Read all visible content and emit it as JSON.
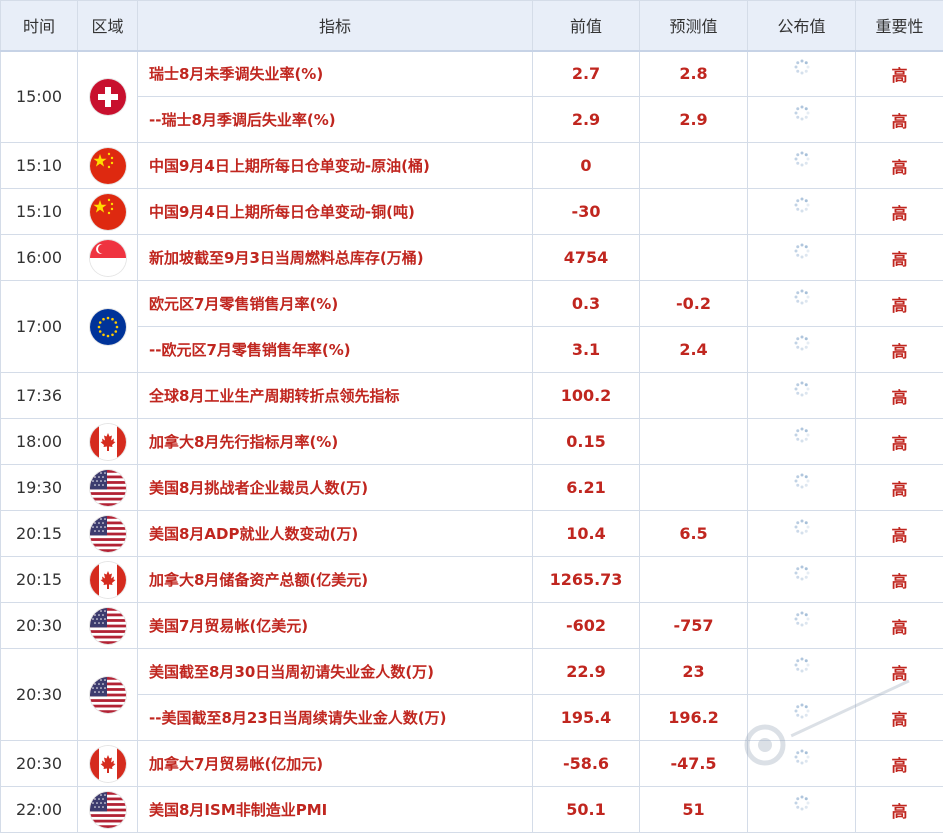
{
  "header": {
    "time": "时间",
    "region": "区域",
    "indicator": "指标",
    "previous": "前值",
    "forecast": "预测值",
    "published": "公布值",
    "importance": "重要性"
  },
  "colors": {
    "accent_red": "#c0261f",
    "header_bg": "#e8eef8",
    "border": "#d4dce8"
  },
  "groups": [
    {
      "time": "15:00",
      "flag": "switzerland-flag-icon",
      "rows": [
        {
          "indicator": "瑞士8月未季调失业率(%)",
          "previous": "2.7",
          "forecast": "2.8",
          "importance": "高"
        },
        {
          "indicator": "--瑞士8月季调后失业率(%)",
          "previous": "2.9",
          "forecast": "2.9",
          "importance": "高"
        }
      ]
    },
    {
      "time": "15:10",
      "flag": "china-flag-icon",
      "rows": [
        {
          "indicator": "中国9月4日上期所每日仓单变动-原油(桶)",
          "previous": "0",
          "forecast": "",
          "importance": "高"
        }
      ]
    },
    {
      "time": "15:10",
      "flag": "china-flag-icon",
      "rows": [
        {
          "indicator": "中国9月4日上期所每日仓单变动-铜(吨)",
          "previous": "-30",
          "forecast": "",
          "importance": "高"
        }
      ]
    },
    {
      "time": "16:00",
      "flag": "singapore-flag-icon",
      "rows": [
        {
          "indicator": "新加坡截至9月3日当周燃料总库存(万桶)",
          "previous": "4754",
          "forecast": "",
          "importance": "高"
        }
      ]
    },
    {
      "time": "17:00",
      "flag": "eu-flag-icon",
      "rows": [
        {
          "indicator": "欧元区7月零售销售月率(%)",
          "previous": "0.3",
          "forecast": "-0.2",
          "importance": "高"
        },
        {
          "indicator": "--欧元区7月零售销售年率(%)",
          "previous": "3.1",
          "forecast": "2.4",
          "importance": "高"
        }
      ]
    },
    {
      "time": "17:36",
      "flag": "",
      "rows": [
        {
          "indicator": "全球8月工业生产周期转折点领先指标",
          "previous": "100.2",
          "forecast": "",
          "importance": "高"
        }
      ]
    },
    {
      "time": "18:00",
      "flag": "canada-flag-icon",
      "rows": [
        {
          "indicator": "加拿大8月先行指标月率(%)",
          "previous": "0.15",
          "forecast": "",
          "importance": "高"
        }
      ]
    },
    {
      "time": "19:30",
      "flag": "usa-flag-icon",
      "rows": [
        {
          "indicator": "美国8月挑战者企业裁员人数(万)",
          "previous": "6.21",
          "forecast": "",
          "importance": "高"
        }
      ]
    },
    {
      "time": "20:15",
      "flag": "usa-flag-icon",
      "rows": [
        {
          "indicator": "美国8月ADP就业人数变动(万)",
          "previous": "10.4",
          "forecast": "6.5",
          "importance": "高"
        }
      ]
    },
    {
      "time": "20:15",
      "flag": "canada-flag-icon",
      "rows": [
        {
          "indicator": "加拿大8月储备资产总额(亿美元)",
          "previous": "1265.73",
          "forecast": "",
          "importance": "高"
        }
      ]
    },
    {
      "time": "20:30",
      "flag": "usa-flag-icon",
      "rows": [
        {
          "indicator": "美国7月贸易帐(亿美元)",
          "previous": "-602",
          "forecast": "-757",
          "importance": "高"
        }
      ]
    },
    {
      "time": "20:30",
      "flag": "usa-flag-icon",
      "rows": [
        {
          "indicator": "美国截至8月30日当周初请失业金人数(万)",
          "previous": "22.9",
          "forecast": "23",
          "importance": "高"
        },
        {
          "indicator": "--美国截至8月23日当周续请失业金人数(万)",
          "previous": "195.4",
          "forecast": "196.2",
          "importance": "高"
        }
      ]
    },
    {
      "time": "20:30",
      "flag": "canada-flag-icon",
      "rows": [
        {
          "indicator": "加拿大7月贸易帐(亿加元)",
          "previous": "-58.6",
          "forecast": "-47.5",
          "importance": "高"
        }
      ]
    },
    {
      "time": "22:00",
      "flag": "usa-flag-icon",
      "rows": [
        {
          "indicator": "美国8月ISM非制造业PMI",
          "previous": "50.1",
          "forecast": "51",
          "importance": "高"
        }
      ]
    }
  ]
}
